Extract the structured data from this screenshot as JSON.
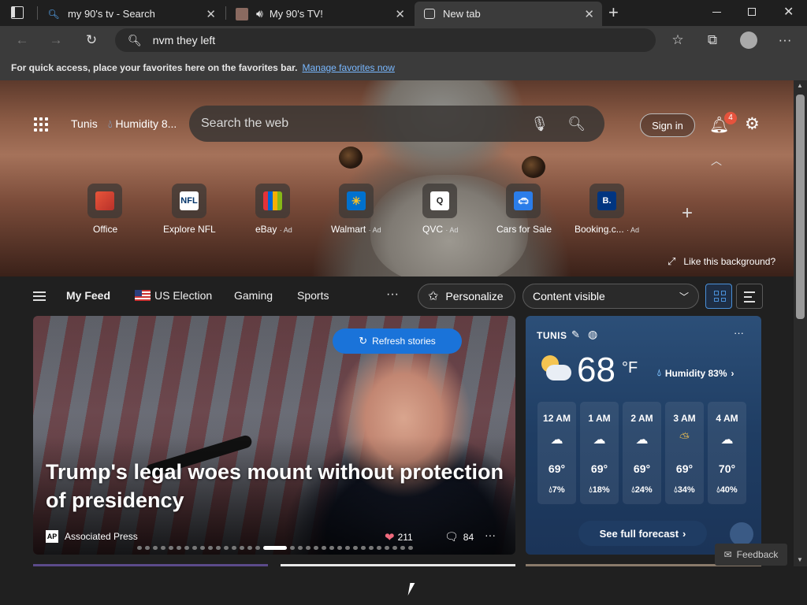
{
  "tabs": [
    {
      "title": "my 90's tv - Search",
      "icon": "search-icon"
    },
    {
      "title": "My 90's TV!",
      "icon": "speaker-icon"
    },
    {
      "title": "New tab",
      "icon": "newtab-icon"
    }
  ],
  "address_bar": {
    "value": "nvm they left"
  },
  "favorites_bar": {
    "message": "For quick access, place your favorites here on the favorites bar.",
    "link": "Manage favorites now"
  },
  "hero": {
    "location": "Tunis",
    "humidity_short": "Humidity 8...",
    "search_placeholder": "Search the web",
    "sign_in": "Sign in",
    "notification_count": "4",
    "like_background": "Like this background?"
  },
  "quick_links": [
    {
      "label": "Office",
      "ad": ""
    },
    {
      "label": "Explore NFL",
      "ad": ""
    },
    {
      "label": "eBay",
      "ad": "· Ad"
    },
    {
      "label": "Walmart",
      "ad": "· Ad"
    },
    {
      "label": "QVC",
      "ad": "· Ad"
    },
    {
      "label": "Cars for Sale",
      "ad": ""
    },
    {
      "label": "Booking.c...",
      "ad": "· Ad"
    }
  ],
  "feed_nav": {
    "my_feed": "My Feed",
    "items": [
      "US Election",
      "Gaming",
      "Sports"
    ],
    "more": "···",
    "personalize": "Personalize",
    "content_select": "Content visible"
  },
  "main_story": {
    "refresh": "Refresh stories",
    "headline": "Trump's legal woes mount without protection of presidency",
    "source": "Associated Press",
    "source_logo": "AP",
    "reactions": "211",
    "comments": "84"
  },
  "weather": {
    "city": "TUNIS",
    "temp": "68",
    "unit": "°F",
    "humidity": "Humidity 83%",
    "hours": [
      {
        "time": "12 AM",
        "icon": "cloud-icon",
        "temp": "69°",
        "precip": "7%"
      },
      {
        "time": "1 AM",
        "icon": "cloud-icon",
        "temp": "69°",
        "precip": "18%"
      },
      {
        "time": "2 AM",
        "icon": "cloud-icon",
        "temp": "69°",
        "precip": "24%"
      },
      {
        "time": "3 AM",
        "icon": "partly-cloudy-icon",
        "temp": "69°",
        "precip": "34%"
      },
      {
        "time": "4 AM",
        "icon": "rain-cloud-icon",
        "temp": "70°",
        "precip": "40%"
      }
    ],
    "see_full": "See full forecast"
  },
  "feedback": "Feedback"
}
